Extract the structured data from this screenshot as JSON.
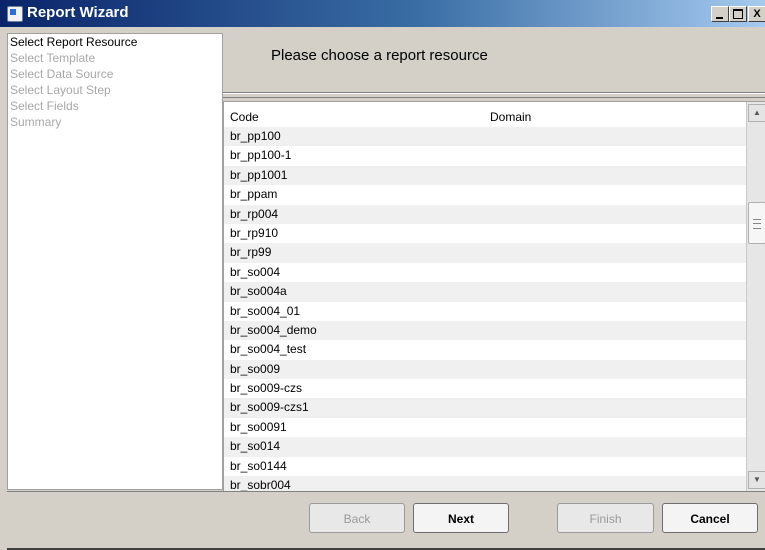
{
  "window": {
    "title": "Report Wizard",
    "controls": {
      "minimize": "_",
      "maximize": "□",
      "close": "X"
    }
  },
  "steps": [
    {
      "label": "Select Report Resource",
      "active": true
    },
    {
      "label": "Select Template",
      "active": false
    },
    {
      "label": "Select Data Source",
      "active": false
    },
    {
      "label": "Select Layout Step",
      "active": false
    },
    {
      "label": "Select Fields",
      "active": false
    },
    {
      "label": "Summary",
      "active": false
    }
  ],
  "header": {
    "prompt": "Please choose a report resource"
  },
  "table": {
    "columns": [
      "Code",
      "Domain"
    ],
    "rows": [
      "br_pp100",
      "br_pp100-1",
      "br_pp1001",
      "br_ppam",
      "br_rp004",
      "br_rp910",
      "br_rp99",
      "br_so004",
      "br_so004a",
      "br_so004_01",
      "br_so004_demo",
      "br_so004_test",
      "br_so009",
      "br_so009-czs",
      "br_so009-czs1",
      "br_so0091",
      "br_so014",
      "br_so0144",
      "br_sobr004"
    ]
  },
  "buttons": {
    "back": "Back",
    "next": "Next",
    "finish": "Finish",
    "cancel": "Cancel"
  },
  "icons": {
    "app": "app-icon",
    "scroll_up": "chevron-up-icon",
    "scroll_down": "chevron-down-icon"
  }
}
